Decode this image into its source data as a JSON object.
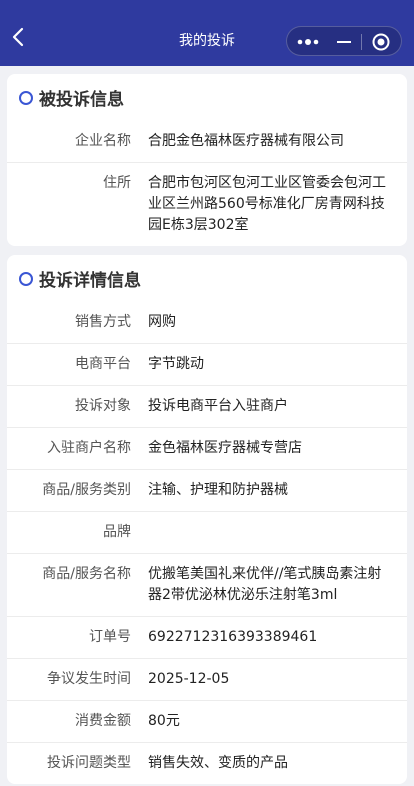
{
  "header": {
    "title": "我的投诉",
    "back_icon": "chevron-left-icon",
    "more_icon": "more-dots-icon",
    "minimize_icon": "minimize-icon",
    "close_icon": "target-close-icon",
    "colors": {
      "nav_bg": "#2f3a9f",
      "accent": "#3a56d4"
    }
  },
  "company_section": {
    "title": "被投诉信息",
    "rows": [
      {
        "label": "企业名称",
        "value": "合肥金色福林医疗器械有限公司"
      },
      {
        "label": "住所",
        "value": "合肥市包河区包河工业区管委会包河工业区兰州路560号标准化厂房青网科技园E栋3层302室"
      }
    ]
  },
  "detail_section": {
    "title": "投诉详情信息",
    "rows": [
      {
        "label": "销售方式",
        "value": "网购"
      },
      {
        "label": "电商平台",
        "value": "字节跳动"
      },
      {
        "label": "投诉对象",
        "value": "投诉电商平台入驻商户"
      },
      {
        "label": "入驻商户名称",
        "value": "金色福林医疗器械专营店"
      },
      {
        "label": "商品/服务类别",
        "value": "注输、护理和防护器械"
      },
      {
        "label": "品牌",
        "value": ""
      },
      {
        "label": "商品/服务名称",
        "value": "优搬笔美国礼来优伴//笔式胰岛素注射器2带优泌林优泌乐注射笔3ml"
      },
      {
        "label": "订单号",
        "value": "6922712316393389461"
      },
      {
        "label": "争议发生时间",
        "value": "2025-12-05"
      },
      {
        "label": "消费金额",
        "value": "80元"
      },
      {
        "label": "投诉问题类型",
        "value": "销售失效、变质的产品"
      }
    ]
  }
}
